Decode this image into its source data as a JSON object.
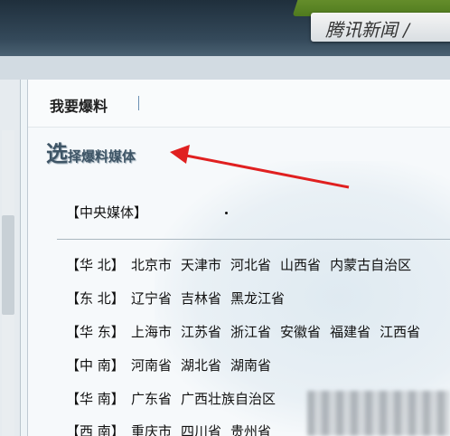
{
  "banner": {
    "slogan": "腾讯新闻 /"
  },
  "tab": {
    "label": "我要爆料"
  },
  "section": {
    "title_big": "选",
    "title_small": "择爆料媒体"
  },
  "central_media": "【中央媒体】",
  "regions": [
    {
      "region": "【华 北】",
      "provinces": [
        "北京市",
        "天津市",
        "河北省",
        "山西省",
        "内蒙古自治区"
      ]
    },
    {
      "region": "【东 北】",
      "provinces": [
        "辽宁省",
        "吉林省",
        "黑龙江省"
      ]
    },
    {
      "region": "【华 东】",
      "provinces": [
        "上海市",
        "江苏省",
        "浙江省",
        "安徽省",
        "福建省",
        "江西省"
      ]
    },
    {
      "region": "【中 南】",
      "provinces": [
        "河南省",
        "湖北省",
        "湖南省"
      ]
    },
    {
      "region": "【华 南】",
      "provinces": [
        "广东省",
        "广西壮族自治区"
      ]
    },
    {
      "region": "【西 南】",
      "provinces": [
        "重庆市",
        "四川省",
        "贵州省"
      ]
    }
  ],
  "colors": {
    "annotation_arrow": "#e02020",
    "banner_dark": "#1f2f3c",
    "banner_green": "#6f9a2e"
  }
}
